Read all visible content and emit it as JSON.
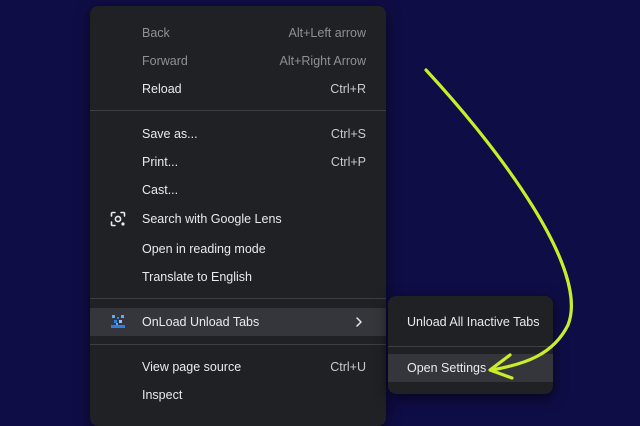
{
  "colors": {
    "desktop_background": "#0f0d45",
    "menu_background": "#202124",
    "highlight": "#34363b",
    "annotation_arrow": "#c8ee2a"
  },
  "context_menu": {
    "items": [
      {
        "label": "Back",
        "shortcut": "Alt+Left arrow",
        "disabled": true
      },
      {
        "label": "Forward",
        "shortcut": "Alt+Right Arrow",
        "disabled": true
      },
      {
        "label": "Reload",
        "shortcut": "Ctrl+R"
      },
      {
        "label": "Save as...",
        "shortcut": "Ctrl+S"
      },
      {
        "label": "Print...",
        "shortcut": "Ctrl+P"
      },
      {
        "label": "Cast..."
      },
      {
        "label": "Search with Google Lens",
        "icon": "google-lens-icon"
      },
      {
        "label": "Open in reading mode"
      },
      {
        "label": "Translate to English"
      },
      {
        "label": "OnLoad Unload Tabs",
        "icon": "onload-extension-icon",
        "has_submenu": true,
        "highlighted": true
      },
      {
        "label": "View page source",
        "shortcut": "Ctrl+U"
      },
      {
        "label": "Inspect"
      }
    ]
  },
  "submenu": {
    "items": [
      {
        "label": "Unload All Inactive Tabs"
      },
      {
        "label": "Open Settings",
        "highlighted": true
      }
    ]
  }
}
